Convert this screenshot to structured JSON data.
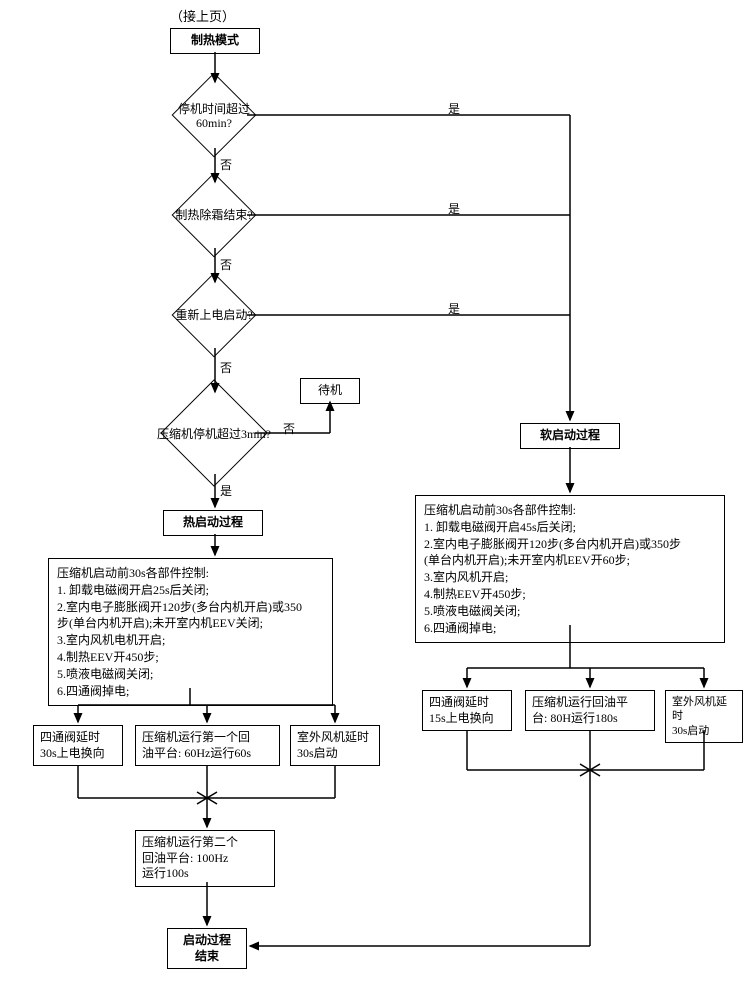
{
  "header_note": "（接上页）",
  "start": "制热模式",
  "d1": "停机时间超过\n60min?",
  "d2": "制热除霜结束?",
  "d3": "重新上电启动?",
  "d4": "压缩机停机超过3min?",
  "standby": "待机",
  "yes": "是",
  "no": "否",
  "hot_start_title": "热启动过程",
  "hot_start_body": "压缩机启动前30s各部件控制:\n1. 卸载电磁阀开启25s后关闭;\n2.室内电子膨胀阀开120步(多台内机开启)或350\n步(单台内机开启);未开室内机EEV关闭;\n3.室内风机电机开启;\n4.制热EEV开450步;\n5.喷液电磁阀关闭;\n6.四通阀掉电;",
  "hot_a": "四通阀延时\n30s上电换向",
  "hot_b": "压缩机运行第一个回\n油平台: 60Hz运行60s",
  "hot_c": "室外风机延时\n30s启动",
  "hot_d": "压缩机运行第二个\n回油平台: 100Hz\n运行100s",
  "soft_start_title": "软启动过程",
  "soft_start_body": "压缩机启动前30s各部件控制:\n1. 卸载电磁阀开启45s后关闭;\n2.室内电子膨胀阀开120步(多台内机开启)或350步\n(单台内机开启);未开室内机EEV开60步;\n3.室内风机开启;\n4.制热EEV开450步;\n5.喷液电磁阀关闭;\n6.四通阀掉电;",
  "soft_a": "四通阀延时\n15s上电换向",
  "soft_b": "压缩机运行回油平\n台: 80H运行180s",
  "soft_c": "室外风机延时\n30s启动",
  "end": "启动过程\n结束"
}
